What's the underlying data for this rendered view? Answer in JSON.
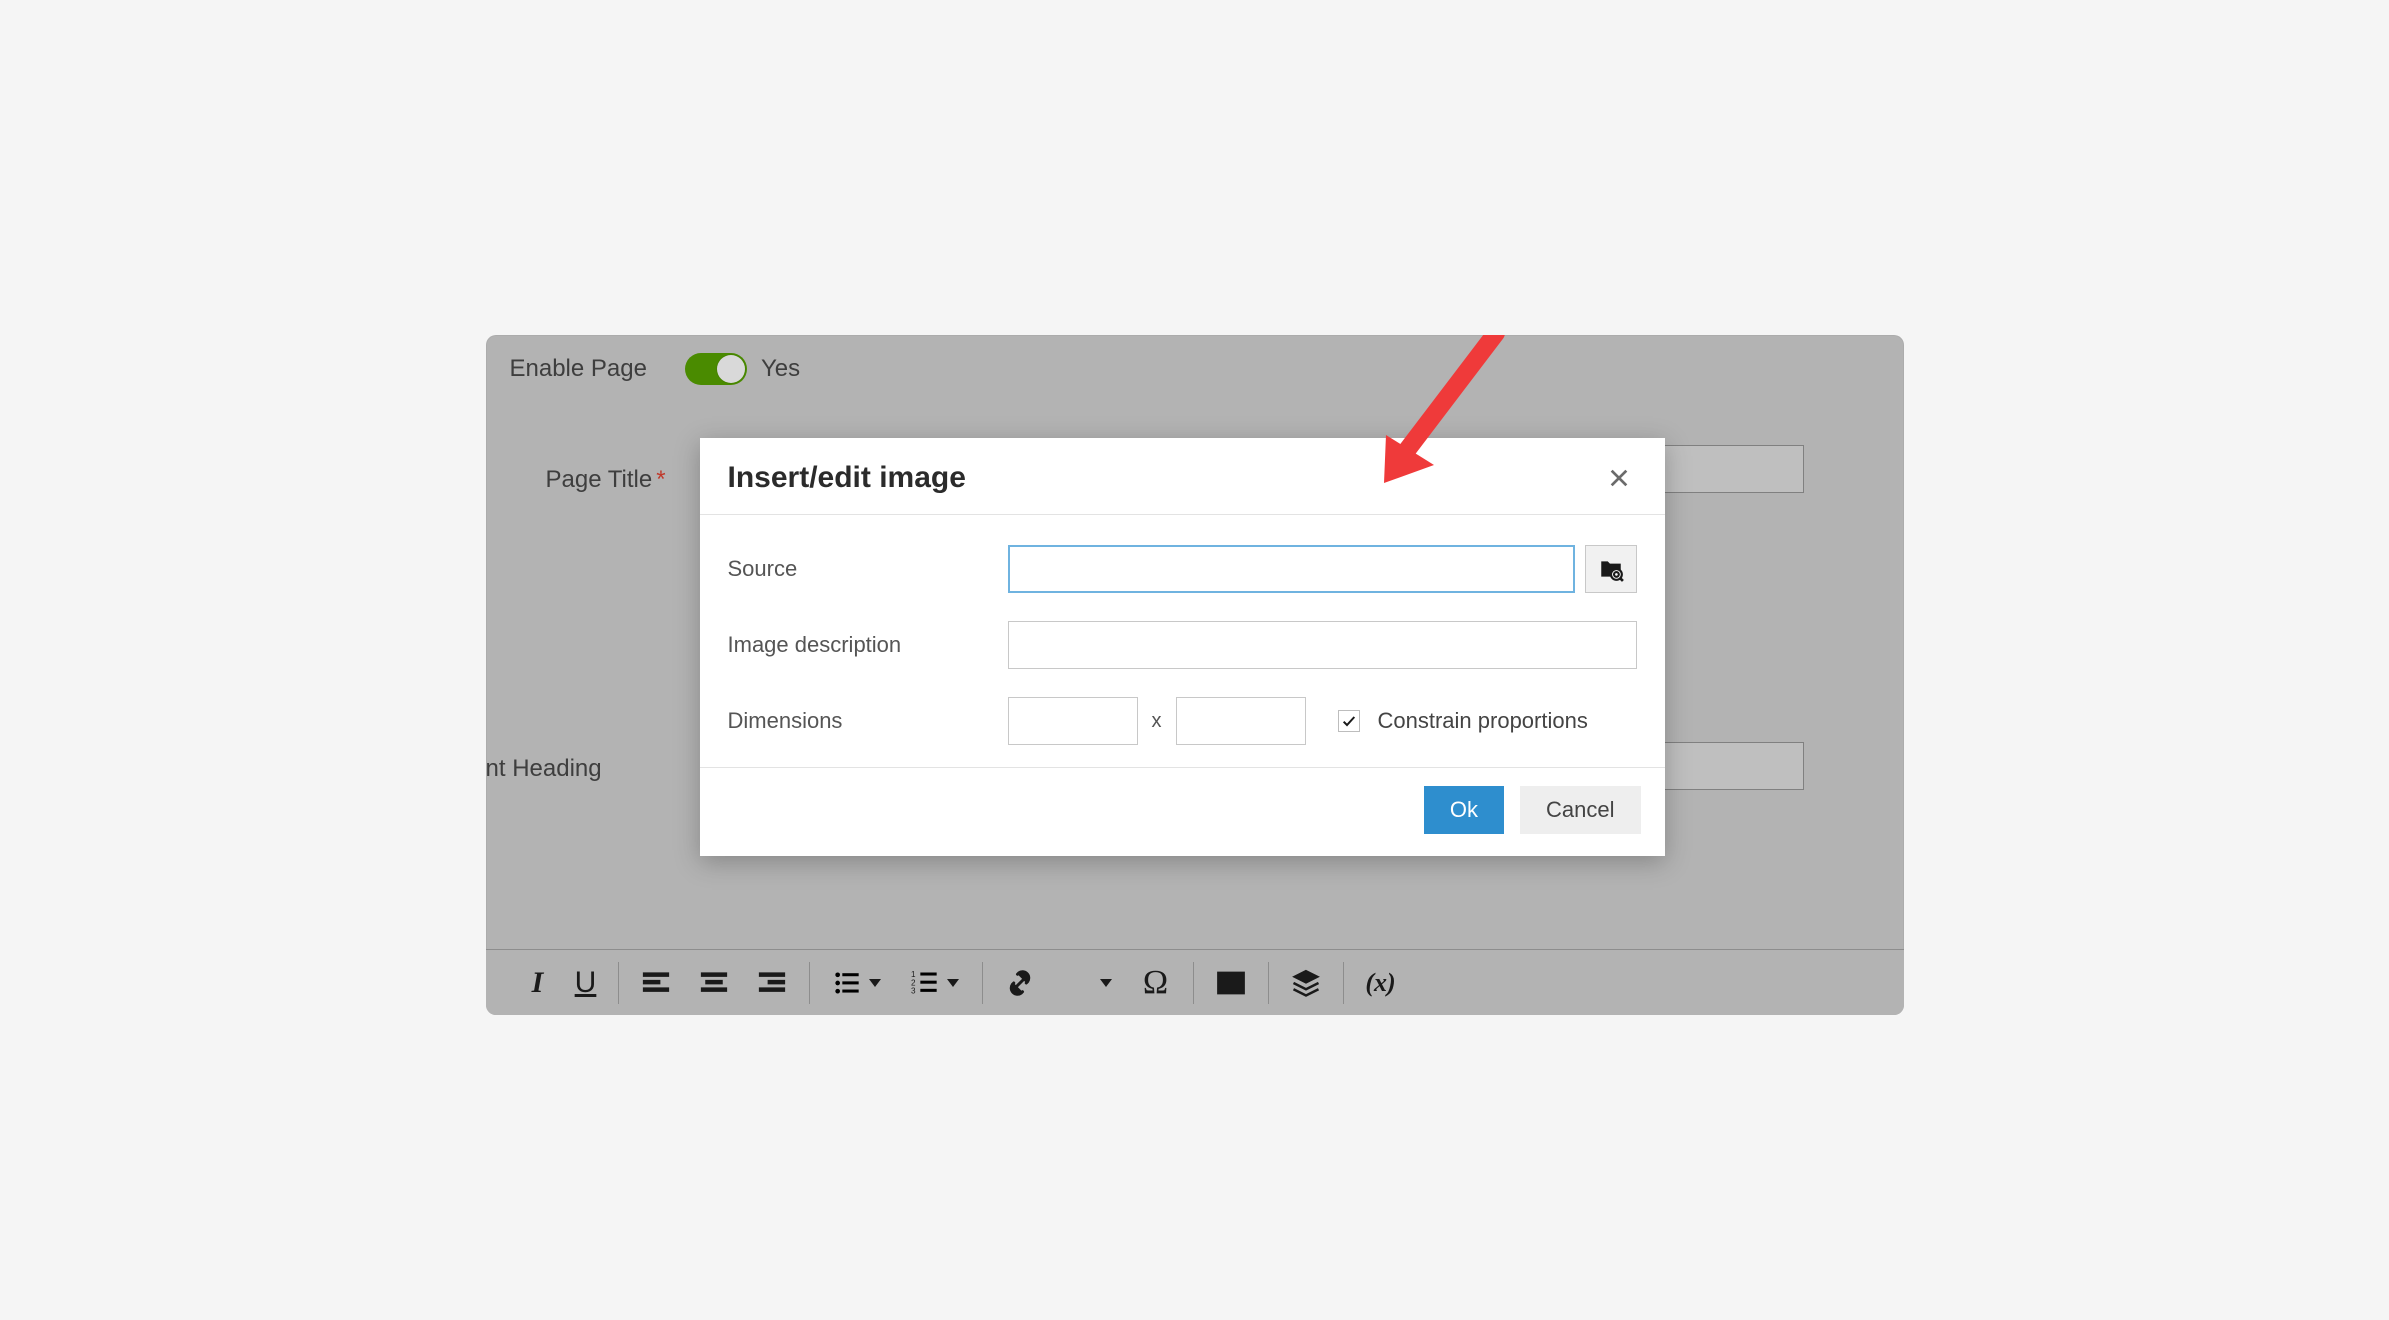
{
  "form": {
    "enable_label": "Enable Page",
    "enable_value": "Yes",
    "page_title_label": "Page Title",
    "content_heading_label": "tent Heading"
  },
  "dialog": {
    "title": "Insert/edit image",
    "source_label": "Source",
    "source_value": "",
    "description_label": "Image description",
    "description_value": "",
    "dimensions_label": "Dimensions",
    "dim_w": "",
    "dim_h": "",
    "dim_sep": "x",
    "constrain_label": "Constrain proportions",
    "ok_label": "Ok",
    "cancel_label": "Cancel"
  },
  "toolbar": {
    "italic": "I",
    "underline": "U",
    "omega": "Ω",
    "variable": "(x)"
  }
}
